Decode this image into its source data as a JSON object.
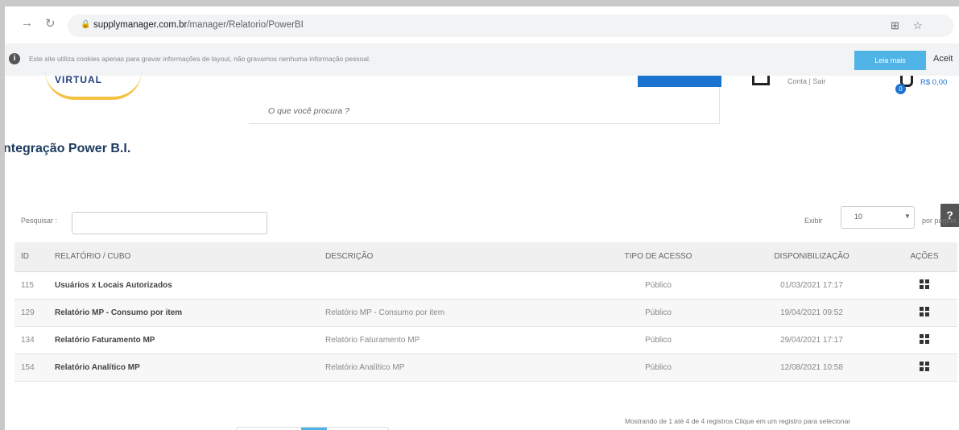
{
  "browser": {
    "url_domain": "supplymanager.com.br",
    "url_path": "/manager/Relatorio/PowerBI",
    "icons": [
      "back-arrow-icon",
      "reload-icon",
      "lock-icon",
      "translate-icon",
      "star-icon"
    ]
  },
  "cookie_notice": {
    "text": "Este site utiliza cookies apenas para gravar informações de layout, não gravamos nenhuma informação pessoal.",
    "read_more": "Leia mais",
    "accept": "Aceit"
  },
  "header": {
    "logo_text": "VIRTUAL",
    "search_hint": "O que você procura ?",
    "login_text": "Conta | Sair",
    "cart_count": "0",
    "cart_total": "R$ 0,00"
  },
  "page": {
    "title": "ntegração Power B.I.",
    "help": "?",
    "search_label": "Pesquisar :",
    "show_label": "Exibir",
    "page_size": "10",
    "per_page": "por página",
    "footer_info": "Mostrando de 1 até 4 de 4 registros   Clique em um registro para selecionar"
  },
  "table": {
    "columns": [
      "ID",
      "RELATÓRIO / CUBO",
      "DESCRIÇÃO",
      "TIPO DE ACESSO",
      "DISPONIBILIZAÇÃO",
      "AÇÕES"
    ],
    "rows": [
      {
        "id": "115",
        "name": "Usuários x Locais Autorizados",
        "desc": "",
        "access": "Público",
        "date": "01/03/2021 17:17"
      },
      {
        "id": "129",
        "name": "Relatório MP - Consumo por item",
        "desc": "Relatório MP - Consumo por item",
        "access": "Público",
        "date": "19/04/2021 09:52"
      },
      {
        "id": "134",
        "name": "Relatório Faturamento MP",
        "desc": "Relatório Faturamento MP",
        "access": "Público",
        "date": "29/04/2021 17:17"
      },
      {
        "id": "154",
        "name": "Relatório Analítico MP",
        "desc": "Relatório Analítico MP",
        "access": "Público",
        "date": "12/08/2021 10:58"
      }
    ]
  },
  "colors": {
    "accent": "#1a73d0",
    "cookie_button": "#4fb3e6",
    "title": "#1c3b5e"
  }
}
